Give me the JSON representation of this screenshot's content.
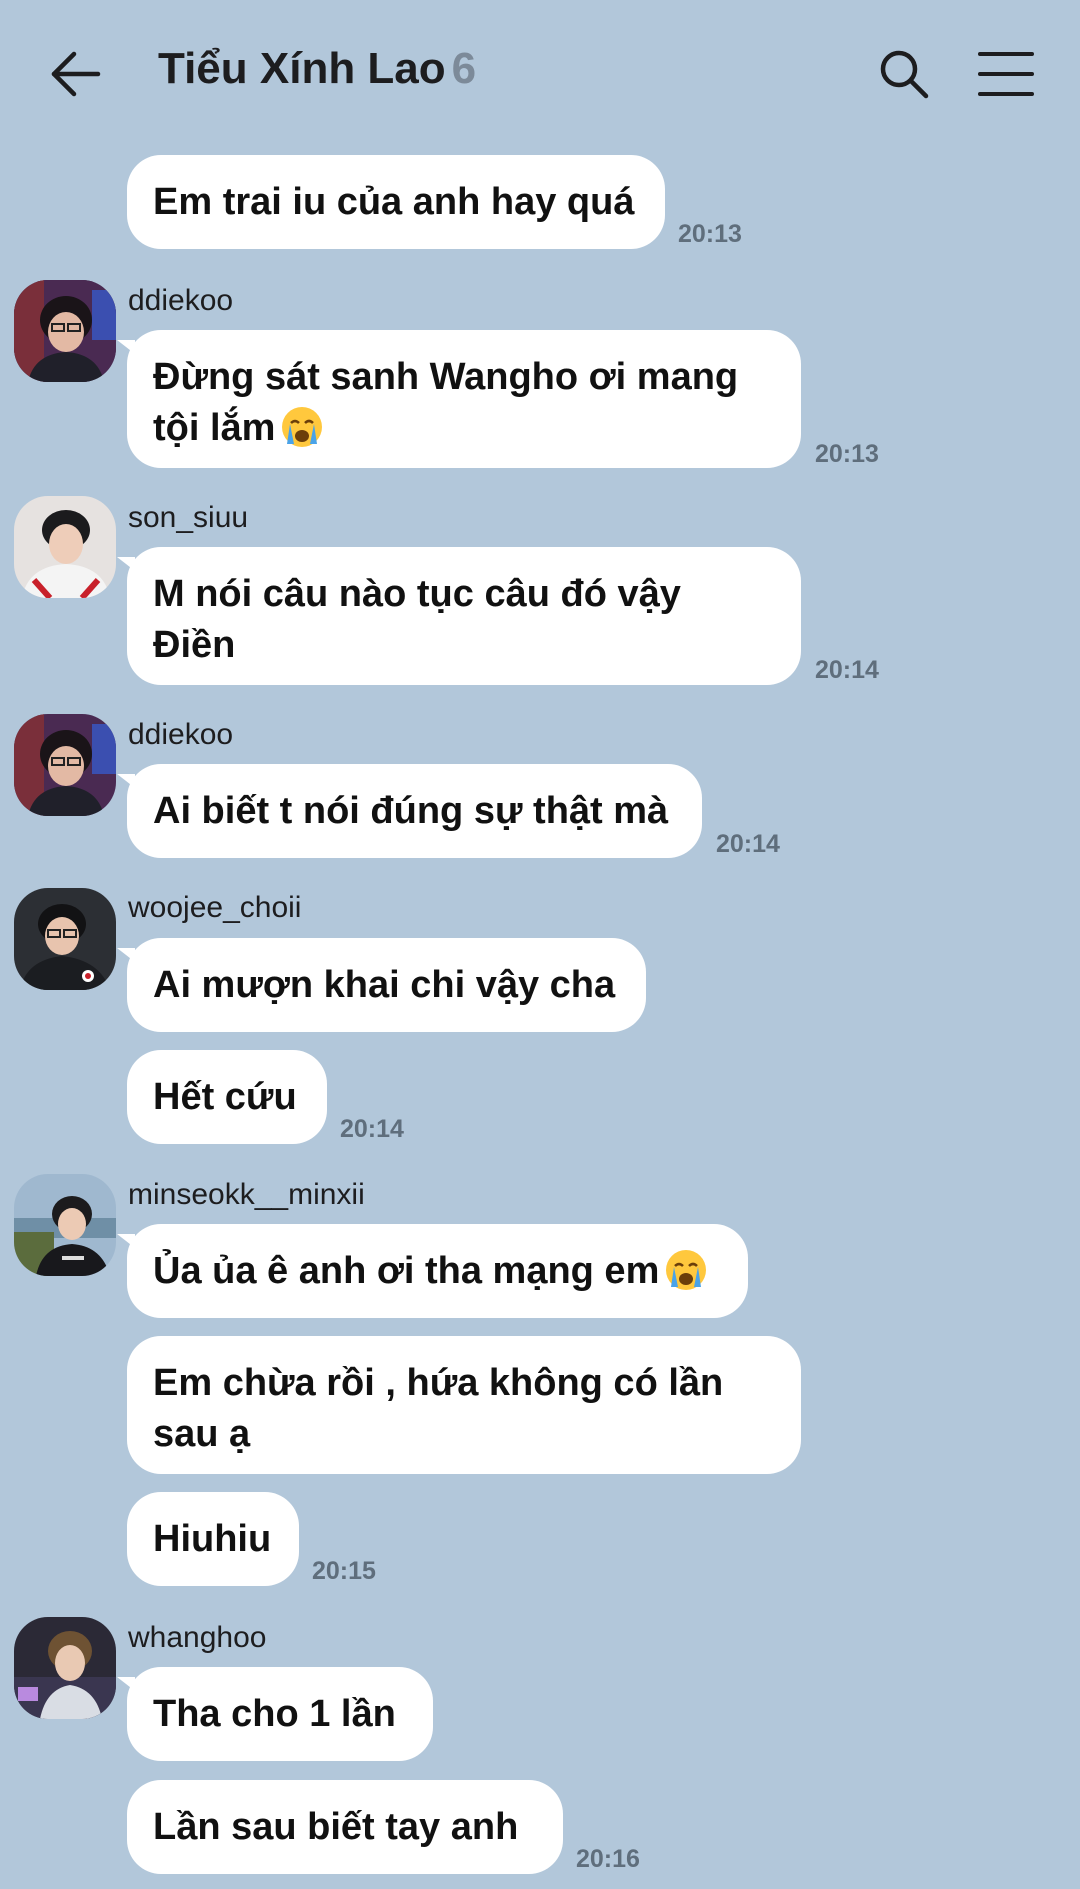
{
  "header": {
    "title": "Tiểu Xính Lao",
    "member_count": "6",
    "back_icon": "arrow-left-icon",
    "search_icon": "search-icon",
    "menu_icon": "hamburger-menu-icon"
  },
  "colors": {
    "background": "#b2c7da",
    "bubble": "#ffffff",
    "text": "#111111",
    "time": "#5f6e7c",
    "count": "#7c8a99"
  },
  "messages": [
    {
      "text": "Em trai iu của anh hay quá",
      "time": "20:13"
    },
    {
      "sender": "ddiekoo",
      "text_line1": "Đừng sát sanh Wangho ơi mang",
      "text_line2": "tội lắm",
      "emoji": "loudly-crying-face-emoji",
      "time": "20:13"
    },
    {
      "sender": "son_siuu",
      "text_line1": "M nói câu nào tục câu đó vậy",
      "text_line2": "Điền",
      "time": "20:14"
    },
    {
      "sender": "ddiekoo",
      "text": "Ai biết t nói đúng sự thật mà",
      "time": "20:14"
    },
    {
      "sender": "woojee_choii",
      "text": "Ai mượn khai chi vậy cha"
    },
    {
      "text": "Hết cứu",
      "time": "20:14"
    },
    {
      "sender": "minseokk__minxii",
      "text": "Ủa ủa ê anh ơi tha mạng em",
      "emoji": "loudly-crying-face-emoji"
    },
    {
      "text_line1": "Em chừa rồi , hứa không có lần",
      "text_line2": "sau ạ"
    },
    {
      "text": "Hiuhiu",
      "time": "20:15"
    },
    {
      "sender": "whanghoo",
      "text": "Tha cho 1 lần"
    },
    {
      "text": "Lần sau biết tay anh",
      "time": "20:16"
    }
  ]
}
